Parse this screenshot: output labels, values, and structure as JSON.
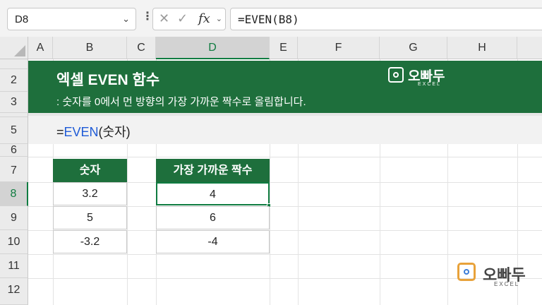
{
  "formula_bar": {
    "name_box": "D8",
    "cancel_icon": "✕",
    "confirm_icon": "✓",
    "fx_label": "fx",
    "formula": "=EVEN(B8)"
  },
  "columns": [
    "A",
    "B",
    "C",
    "D",
    "E",
    "F",
    "G",
    "H"
  ],
  "rows": [
    "2",
    "3",
    "5",
    "6",
    "7",
    "8",
    "9",
    "10",
    "11",
    "12"
  ],
  "selected_cell": "D8",
  "banner": {
    "title": "엑셀 EVEN 함수",
    "subtitle": ": 숫자를 0에서 먼 방향의 가장 가까운 짝수로 올림합니다.",
    "logo_text": "오빠두",
    "logo_sub": "EXCEL",
    "background": "#1e6f3c"
  },
  "syntax": {
    "prefix": "=",
    "function": "EVEN",
    "args": "(숫자)"
  },
  "table_input": {
    "header": "숫자",
    "values": [
      "3.2",
      "5",
      "-3.2"
    ]
  },
  "table_output": {
    "header": "가장 가까운 짝수",
    "values": [
      "4",
      "6",
      "-4"
    ]
  },
  "watermark": {
    "text": "오빠두",
    "sub": "EXCEL"
  },
  "colors": {
    "accent": "#107c41",
    "header_green": "#1e6f3c",
    "function_blue": "#1f5bd6"
  }
}
